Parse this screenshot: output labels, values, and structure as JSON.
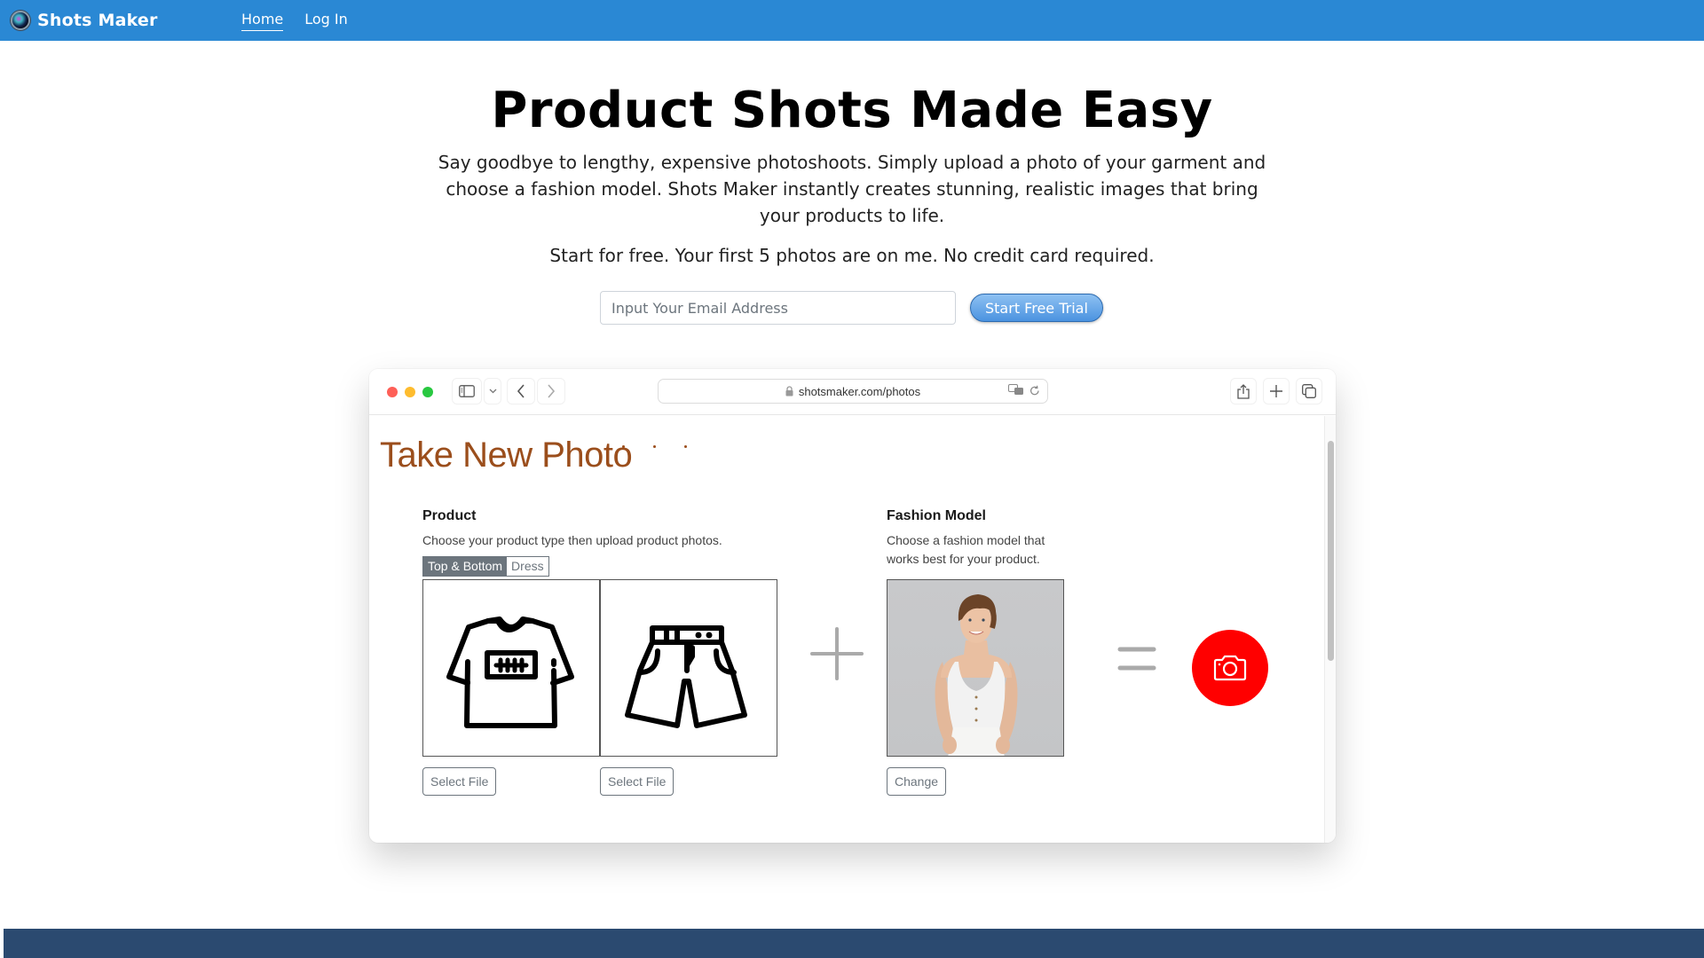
{
  "navbar": {
    "brand": "Shots Maker",
    "brand_icon": "camera-lens-icon",
    "links": [
      {
        "label": "Home",
        "active": true
      },
      {
        "label": "Log In",
        "active": false
      }
    ],
    "color": "#2a88d4"
  },
  "hero": {
    "title": "Product Shots Made Easy",
    "description": "Say goodbye to lengthy, expensive photoshoots. Simply upload a photo of your garment and choose a fashion model. Shots Maker instantly creates stunning, realistic images that bring your products to life.",
    "free_note": "Start for free. Your first 5 photos are on me. No credit card required.",
    "email_placeholder": "Input Your Email Address",
    "email_value": "",
    "cta_label": "Start Free Trial"
  },
  "mock_browser": {
    "url": "shotsmaker.com/photos",
    "toolbar_icons": [
      "sidebar-icon",
      "chevron-down-icon",
      "back-icon",
      "forward-icon",
      "lock-icon",
      "translate-icon",
      "reload-icon",
      "share-icon",
      "new-tab-icon",
      "tabs-overview-icon"
    ],
    "page": {
      "title": "Take New Photo",
      "product": {
        "heading": "Product",
        "description": "Choose your product type then upload product photos.",
        "types": [
          {
            "label": "Top & Bottom",
            "active": true
          },
          {
            "label": "Dress",
            "active": false
          }
        ],
        "slots": [
          {
            "icon": "t-shirt-icon",
            "button": "Select File"
          },
          {
            "icon": "shorts-icon",
            "button": "Select File"
          }
        ]
      },
      "fashion_model": {
        "heading": "Fashion Model",
        "description_line1": "Choose a fashion model that",
        "description_line2": "works best for your product.",
        "button": "Change",
        "photo_alt": "Model in white tank top and white pants"
      },
      "operators": {
        "plus": "plus-icon",
        "equals": "equals-icon"
      },
      "shutter_icon": "camera-icon",
      "accent_color": "#ff0000",
      "title_color": "#9b4e1c"
    }
  },
  "footer": {
    "color": "#2b4a70"
  }
}
